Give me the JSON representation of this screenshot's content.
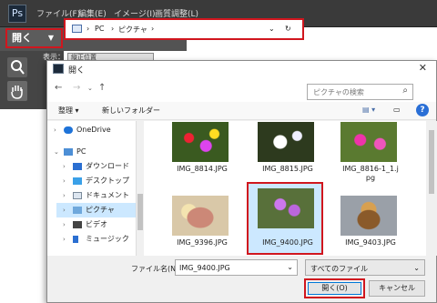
{
  "app": {
    "menus": [
      "ファイル(F)",
      "編集(E)",
      "イメージ(I)",
      "画質調整(L)"
    ],
    "open_label": "開く",
    "display_label": "表示：",
    "display_value": "縦正位置"
  },
  "dialog": {
    "title": "開く",
    "address": [
      "PC",
      "ピクチャ"
    ],
    "search_placeholder": "ピクチャの検索",
    "toolbar": {
      "organize": "整理",
      "new_folder": "新しいフォルダー"
    },
    "tree": [
      "OneDrive",
      "PC",
      "ダウンロード",
      "デスクトップ",
      "ドキュメント",
      "ピクチャ",
      "ビデオ",
      "ミュージック"
    ],
    "files": [
      {
        "name": "IMG_8814.JPG"
      },
      {
        "name": "IMG_8815.JPG"
      },
      {
        "name": "IMG_8816-1_1.j",
        "name2": "pg"
      },
      {
        "name": "IMG_9396.JPG"
      },
      {
        "name": "IMG_9400.JPG"
      },
      {
        "name": "IMG_9403.JPG"
      }
    ],
    "filename_label": "ファイル名(N):",
    "filename_value": "IMG_9400.JPG",
    "filetype_value": "すべてのファイル",
    "open_button": "開く(O)",
    "cancel_button": "キャンセル"
  },
  "colors": {
    "highlight": "#d0161e",
    "selection": "#cce8ff",
    "accent": "#0078d7"
  }
}
